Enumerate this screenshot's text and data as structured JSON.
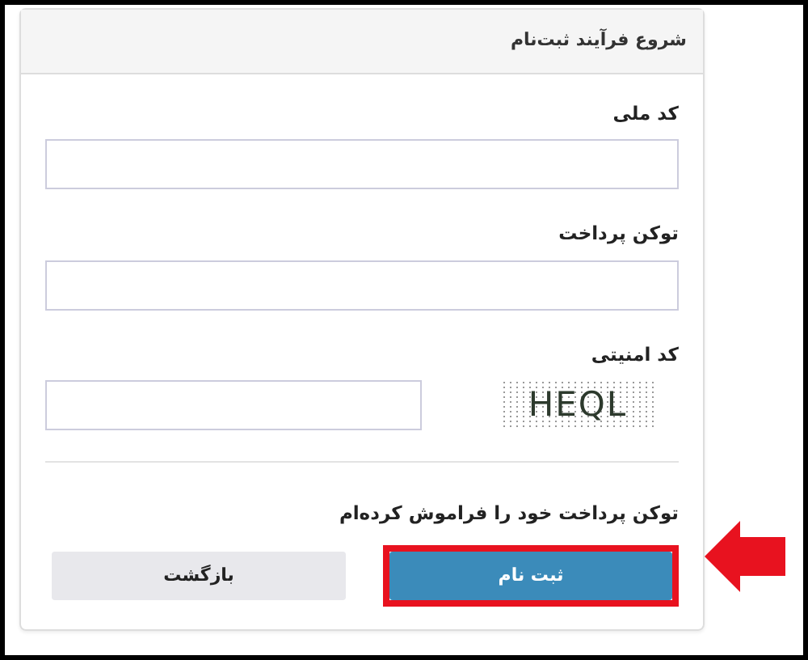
{
  "card": {
    "title": "شروع فرآیند ثبت‌نام"
  },
  "fields": [
    {
      "kind": "text",
      "label": "کد ملی"
    },
    {
      "kind": "text",
      "label": "توکن پرداخت"
    },
    {
      "kind": "captcha",
      "label": "کد امنیتی",
      "captcha": "HEQL"
    }
  ],
  "forgot_link": "توکن پرداخت خود را فراموش کرده‌ام",
  "buttons": [
    {
      "kind": "primary",
      "label": "ثبت نام",
      "highlighted": true
    },
    {
      "kind": "secondary",
      "label": "بازگشت",
      "highlighted": false
    }
  ]
}
